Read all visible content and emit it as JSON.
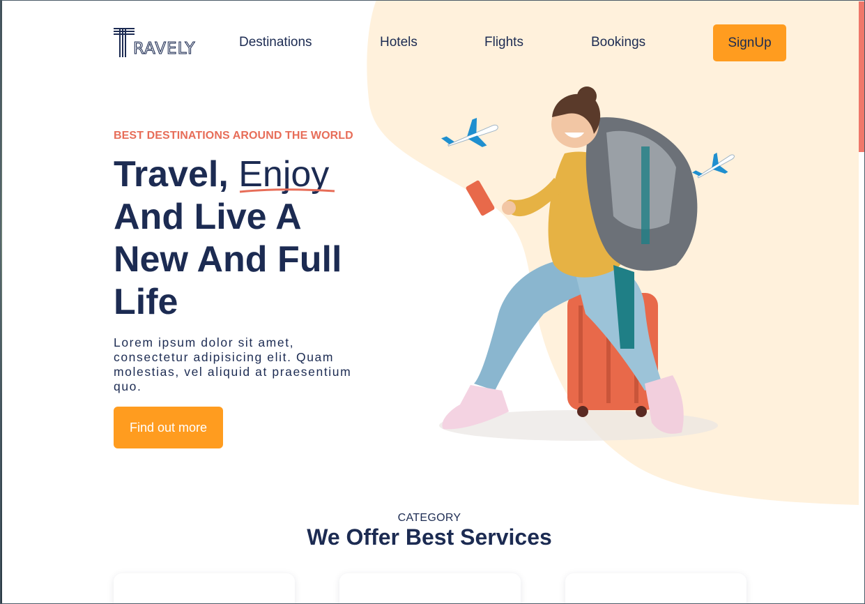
{
  "brand": {
    "logo_text": "RAVELY",
    "logo_initial": "T",
    "name": "Travely"
  },
  "nav": {
    "links": [
      "Destinations",
      "Hotels",
      "Flights",
      "Bookings"
    ],
    "signup_label": "SignUp"
  },
  "hero": {
    "eyebrow": "BEST DESTINATIONS AROUND THE WORLD",
    "headline_start": "Travel, ",
    "headline_highlight": "Enjoy",
    "headline_rest": "And Live A New And Full Life",
    "lede": "Lorem ipsum dolor sit amet, consectetur adipisicing elit. Quam molestias, vel aliquid at praesentium quo.",
    "cta_label": "Find out more"
  },
  "services": {
    "eyebrow": "CATEGORY",
    "title": "We Offer Best Services",
    "cards": 3
  },
  "colors": {
    "accent": "#ff9c1f",
    "navy": "#1c2b52",
    "coral": "#e76d58",
    "cream": "#fff1dc"
  },
  "icons": [
    "logo-icon",
    "plane-icon",
    "plane-icon"
  ]
}
